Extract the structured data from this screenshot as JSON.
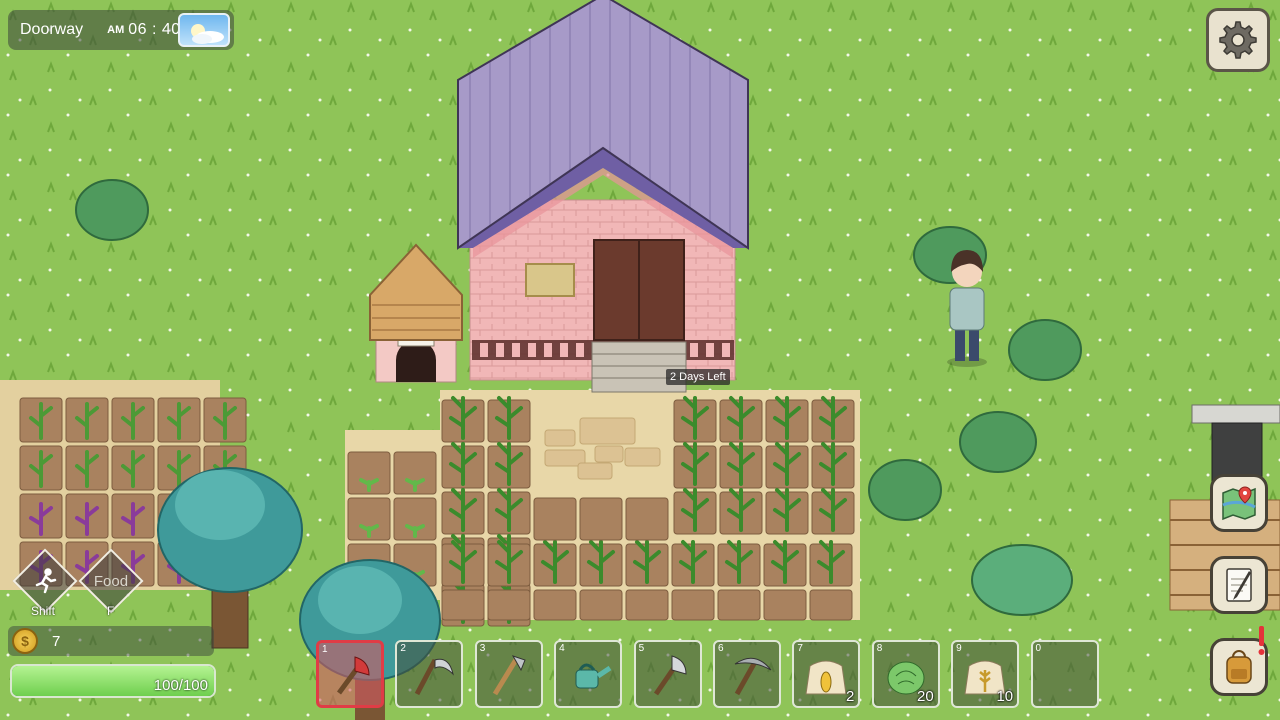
{
  "hud": {
    "location": "Doorway",
    "ampm": "AM",
    "time": "06 : 40",
    "weather_icon": "sunny-weather-icon"
  },
  "tooltip": {
    "text": "2 Days Left"
  },
  "actions": {
    "run_key": "Shift",
    "food_label": "Food",
    "food_key": "F"
  },
  "status": {
    "coins": "7",
    "hp_text": "100/100",
    "hp_fraction": 1.0
  },
  "hotbar": [
    {
      "num": "1",
      "item": "red-axe-icon",
      "count": "",
      "selected": true
    },
    {
      "num": "2",
      "item": "scythe-icon",
      "count": ""
    },
    {
      "num": "3",
      "item": "hoe-icon",
      "count": ""
    },
    {
      "num": "4",
      "item": "watering-can-icon",
      "count": ""
    },
    {
      "num": "5",
      "item": "axe-icon",
      "count": ""
    },
    {
      "num": "6",
      "item": "pickaxe-icon",
      "count": ""
    },
    {
      "num": "7",
      "item": "corn-seed-bag-icon",
      "count": "2"
    },
    {
      "num": "8",
      "item": "cabbage-icon",
      "count": "20"
    },
    {
      "num": "9",
      "item": "wheat-seed-bag-icon",
      "count": "10"
    },
    {
      "num": "0",
      "item": "",
      "count": ""
    }
  ],
  "side_buttons": [
    "settings-gear-icon",
    "map-icon",
    "journal-icon",
    "backpack-icon"
  ],
  "colors": {
    "grass": "#8fc458",
    "roof": "#a79ac8",
    "brick": "#f1b7b7",
    "soil": "#a9825f"
  }
}
